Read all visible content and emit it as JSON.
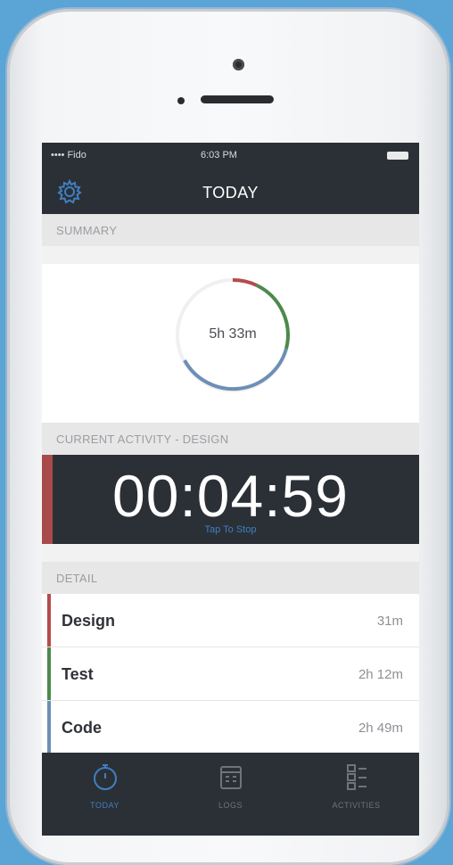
{
  "status_bar": {
    "carrier": "•••• Fido",
    "time": "6:03 PM"
  },
  "nav": {
    "title": "TODAY",
    "settings_icon": "gear-icon"
  },
  "summary": {
    "header": "SUMMARY",
    "total": "5h 33m"
  },
  "current_activity": {
    "header": "CURRENT ACTIVITY - DESIGN",
    "timer": "00:04:59",
    "hint": "Tap To Stop",
    "accent_color": "#a94a4a"
  },
  "detail": {
    "header": "DETAIL",
    "rows": [
      {
        "name": "Design",
        "value": "31m",
        "color": "#b54c4c"
      },
      {
        "name": "Test",
        "value": "2h 12m",
        "color": "#4c8a4c"
      },
      {
        "name": "Code",
        "value": "2h 49m",
        "color": "#6e8fb5"
      }
    ]
  },
  "tabs": [
    {
      "label": "TODAY",
      "icon": "stopwatch-icon",
      "active": true
    },
    {
      "label": "LOGS",
      "icon": "calendar-icon",
      "active": false
    },
    {
      "label": "ACTIVITIES",
      "icon": "list-icon",
      "active": false
    }
  ],
  "colors": {
    "dark": "#2b3036",
    "active_tab": "#3f7fc1",
    "background": "#5aa4d6"
  }
}
